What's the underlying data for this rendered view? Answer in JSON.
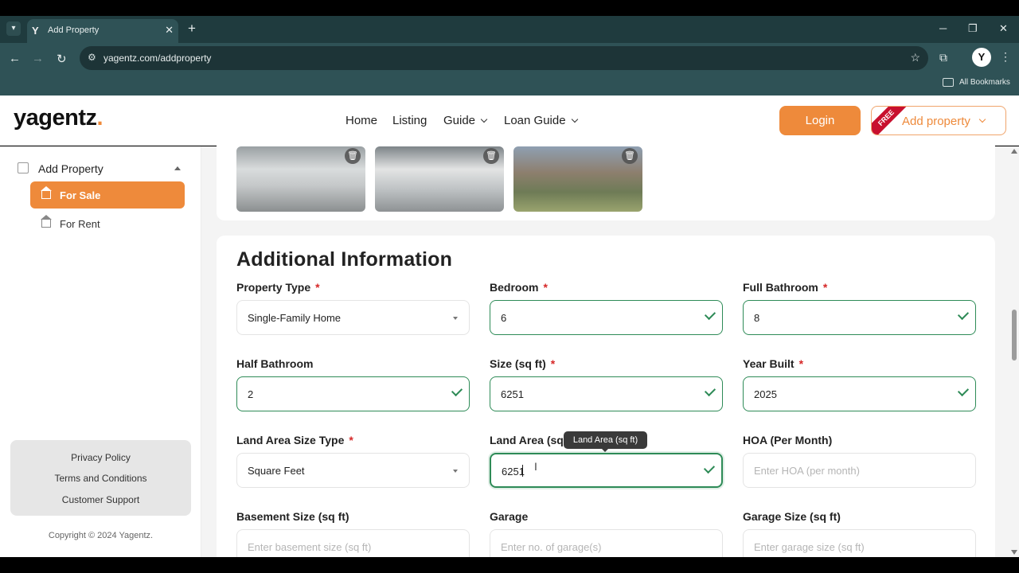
{
  "browser": {
    "tab_title": "Add Property",
    "url": "yagentz.com/addproperty",
    "bookmarks_label": "All Bookmarks",
    "profile_initial": "Y"
  },
  "header": {
    "logo": "yagentz",
    "logo_dot": ".",
    "nav": [
      "Home",
      "Listing",
      "Guide",
      "Loan Guide"
    ],
    "login_label": "Login",
    "add_property_label": "Add property",
    "free_badge": "FREE",
    "accent_color": "#ee8a3b"
  },
  "sidebar": {
    "heading": "Add Property",
    "items": [
      {
        "label": "For Sale",
        "active": true
      },
      {
        "label": "For Rent",
        "active": false
      }
    ],
    "footer_links": [
      "Privacy Policy",
      "Terms and Conditions",
      "Customer Support"
    ],
    "copyright": "Copyright © 2024 Yagentz."
  },
  "main": {
    "section_title": "Additional Information",
    "fields": {
      "property_type": {
        "label": "Property Type",
        "value": "Single-Family Home",
        "required": "*"
      },
      "bedroom": {
        "label": "Bedroom",
        "value": "6",
        "required": "*"
      },
      "full_bathroom": {
        "label": "Full Bathroom",
        "value": "8",
        "required": "*"
      },
      "half_bathroom": {
        "label": "Half Bathroom",
        "value": "2"
      },
      "size": {
        "label": "Size (sq ft)",
        "value": "6251",
        "required": "*"
      },
      "year_built": {
        "label": "Year Built",
        "value": "2025",
        "required": "*"
      },
      "land_area_type": {
        "label": "Land Area Size Type",
        "value": "Square Feet",
        "required": "*"
      },
      "land_area": {
        "label": "Land Area (sq",
        "value": "6251",
        "tooltip": "Land Area (sq ft)"
      },
      "hoa": {
        "label": "HOA (Per Month)",
        "placeholder": "Enter HOA (per month)"
      },
      "basement": {
        "label": "Basement Size (sq ft)",
        "placeholder": "Enter basement size (sq ft)"
      },
      "garage": {
        "label": "Garage",
        "placeholder": "Enter no. of garage(s)"
      },
      "garage_size": {
        "label": "Garage Size (sq ft)",
        "placeholder": "Enter garage size (sq ft)"
      }
    }
  }
}
